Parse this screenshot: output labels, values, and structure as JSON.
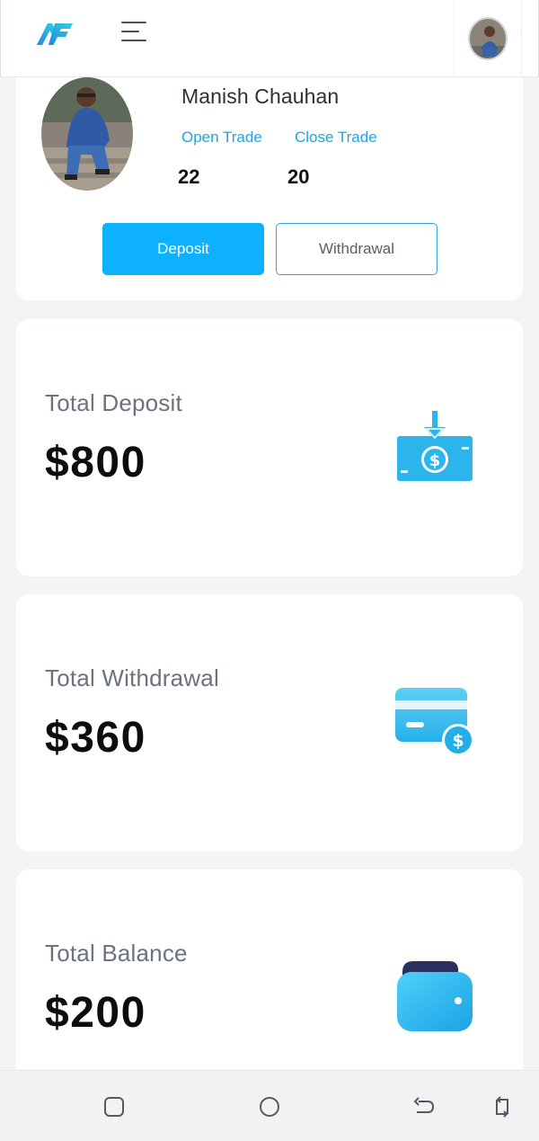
{
  "header": {
    "logo_icon": "brand-logo-icon",
    "menu_icon": "hamburger-menu-icon",
    "avatar_icon": "user-avatar"
  },
  "profile": {
    "name": "Manish Chauhan",
    "open_trade_label": "Open Trade",
    "close_trade_label": "Close Trade",
    "open_trade_count": "22",
    "close_trade_count": "20",
    "deposit_button": "Deposit",
    "withdrawal_button": "Withdrawal"
  },
  "stats": [
    {
      "label": "Total Deposit",
      "value": "$800",
      "icon": "cash-deposit-icon"
    },
    {
      "label": "Total Withdrawal",
      "value": "$360",
      "icon": "card-dollar-icon"
    },
    {
      "label": "Total Balance",
      "value": "$200",
      "icon": "wallet-icon"
    }
  ],
  "navbar": {
    "icons": [
      "recent-apps-icon",
      "home-icon",
      "back-icon",
      "rotate-icon"
    ]
  },
  "colors": {
    "accent": "#0eb1ff",
    "link": "#1aa6e6",
    "icon_blue": "#2bb5ec",
    "page_bg": "#f3f4f6"
  }
}
